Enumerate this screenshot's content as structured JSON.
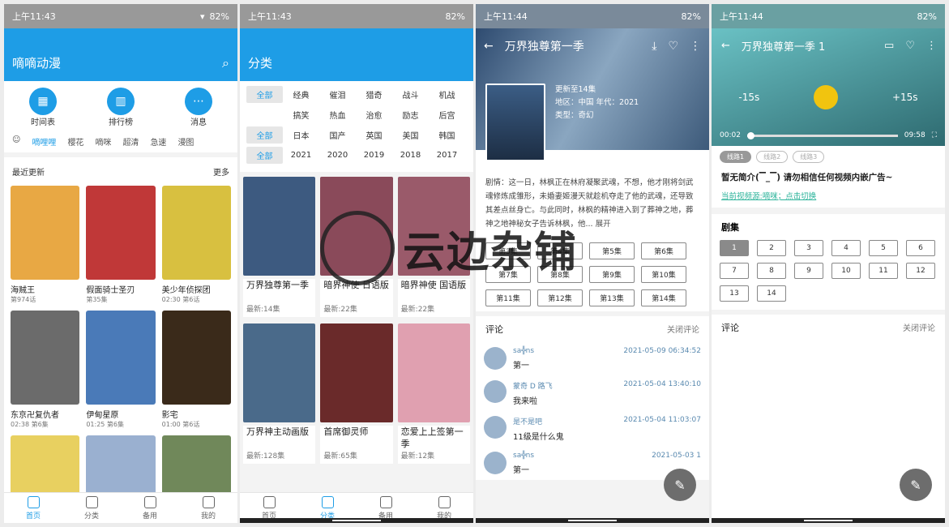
{
  "status": {
    "time1": "上午11:43",
    "time2": "上午11:44",
    "battery": "82%"
  },
  "p1": {
    "title": "嘀嘀动漫",
    "quick": [
      "时间表",
      "排行榜",
      "消息"
    ],
    "tabs": [
      "嘀哩哩",
      "樱花",
      "嘀咪",
      "超清",
      "急速",
      "漫图"
    ],
    "section": "最近更新",
    "more": "更多",
    "cards": [
      {
        "n": "海贼王",
        "s": "第974话",
        "c": "#e8a844"
      },
      {
        "n": "假面骑士圣刃",
        "s": "第35集",
        "c": "#c03838"
      },
      {
        "n": "美少年侦探团",
        "s": "02:30 第6话",
        "c": "#d8c040"
      },
      {
        "n": "东京卍复仇者",
        "s": "02:38 第6集",
        "c": "#6b6b6b"
      },
      {
        "n": "伊甸星原",
        "s": "01:25 第6集",
        "c": "#4a7ab8"
      },
      {
        "n": "影宅",
        "s": "01:00 第6话",
        "c": "#3a2a1a"
      },
      {
        "n": "",
        "s": "",
        "c": "#e8d060"
      },
      {
        "n": "",
        "s": "",
        "c": "#9ab0d0"
      },
      {
        "n": "",
        "s": "",
        "c": "#70885a"
      }
    ]
  },
  "nav": [
    "首页",
    "分类",
    "备用",
    "我的"
  ],
  "p2": {
    "title": "分类",
    "rows": [
      [
        "全部",
        "经典",
        "催泪",
        "猎奇",
        "战斗",
        "机战"
      ],
      [
        "",
        "搞笑",
        "热血",
        "治愈",
        "励志",
        "后宫"
      ],
      [
        "全部",
        "日本",
        "国产",
        "英国",
        "美国",
        "韩国"
      ],
      [
        "全部",
        "2021",
        "2020",
        "2019",
        "2018",
        "2017"
      ]
    ],
    "cards": [
      {
        "n": "万界独尊第一季",
        "s": "最新:14集",
        "c": "#3d5a80"
      },
      {
        "n": "暗界神使 日语版",
        "s": "最新:22集",
        "c": "#8a4a5a"
      },
      {
        "n": "暗界神使 国语版",
        "s": "最新:22集",
        "c": "#9a5a6a"
      },
      {
        "n": "万界神主动画版",
        "s": "最新:128集",
        "c": "#4a6a8a"
      },
      {
        "n": "首席御灵师",
        "s": "最新:65集",
        "c": "#6a2a2a"
      },
      {
        "n": "恋爱上上签第一季",
        "s": "最新:12集",
        "c": "#e0a0b0"
      }
    ]
  },
  "p3": {
    "title": "万界独尊第一季",
    "upd": "更新至14集",
    "region": "地区：中国 年代：2021",
    "type": "类型：奇幻",
    "syn": "剧情：这一日，林枫正在林府凝聚武魂，不想，他才刚将剑武魂修炼成雏形，未婚妻姬漫天就趁机夺走了他的武魂，还导致其差点丝身亡。与此同时，林枫的精神进入到了葬神之地，葬神之地神秘女子告诉林枫，他...",
    "expand": "展开",
    "eps": [
      "第3集",
      "第4集",
      "第5集",
      "第6集",
      "第7集",
      "第8集",
      "第9集",
      "第10集",
      "第11集",
      "第12集",
      "第13集",
      "第14集"
    ],
    "cm_title": "评论",
    "cm_close": "关闭评论",
    "comments": [
      {
        "u": "sa╬ns",
        "t": "2021-05-09 06:34:52",
        "m": "第一"
      },
      {
        "u": "蒙奇 D 路飞",
        "t": "2021-05-04 13:40:10",
        "m": "我来啦"
      },
      {
        "u": "是不是吧",
        "t": "2021-05-04 11:03:07",
        "m": "11级是什么鬼"
      },
      {
        "u": "sa╬ns",
        "t": "2021-05-03 1",
        "m": "第一"
      }
    ]
  },
  "p4": {
    "title": "万界独尊第一季 1",
    "back": "-15s",
    "fwd": "+15s",
    "cur": "00:02",
    "dur": "09:58",
    "lines": [
      "线路1",
      "线路2",
      "线路3"
    ],
    "notice": "暂无简介(▔_▔) 请勿相信任何视频内嵌广告~",
    "source": "当前视频源:嘀咪；点击切换",
    "ep_title": "剧集",
    "eps": [
      "1",
      "2",
      "3",
      "4",
      "5",
      "6",
      "7",
      "8",
      "9",
      "10",
      "11",
      "12",
      "13",
      "14"
    ],
    "cm_title": "评论",
    "cm_close": "关闭评论"
  },
  "watermark": "云边杂铺"
}
